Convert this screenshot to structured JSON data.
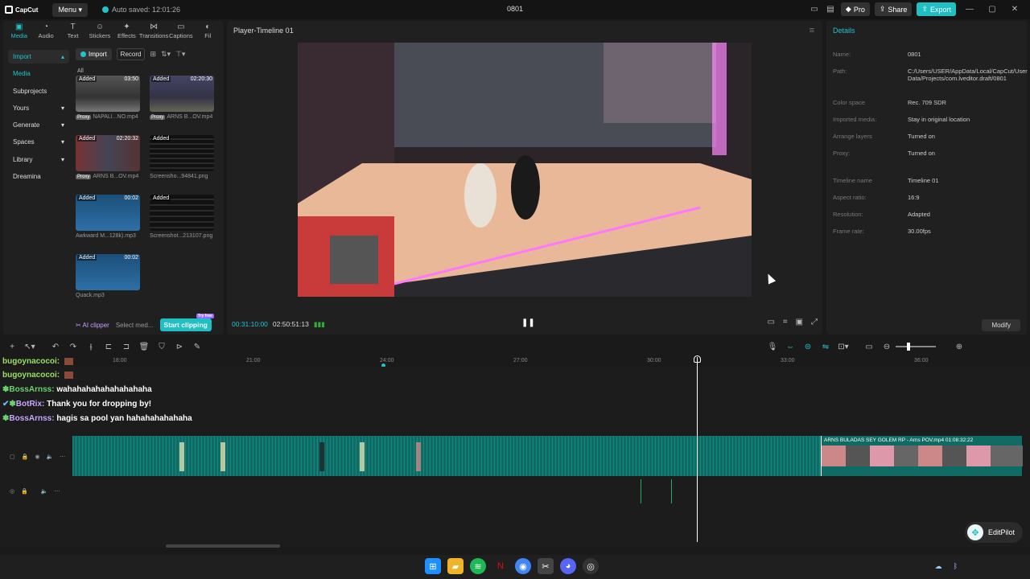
{
  "titlebar": {
    "logo": "CapCut",
    "menu": "Menu",
    "autosave": "Auto saved: 12:01:26",
    "project": "0801",
    "pro": "Pro",
    "share": "Share",
    "export": "Export"
  },
  "media": {
    "tabs": [
      "Media",
      "Audio",
      "Text",
      "Stickers",
      "Effects",
      "Transitions",
      "Captions",
      "Fil"
    ],
    "nav": [
      "Import",
      "Media",
      "Subprojects",
      "Yours",
      "Generate",
      "Spaces",
      "Library",
      "Dreamina"
    ],
    "import_btn": "Import",
    "record_btn": "Record",
    "all": "All",
    "items": [
      {
        "added": "Added",
        "dur": "03:50",
        "name": "NAPALI...NO.mp4",
        "proxy": "Proxy"
      },
      {
        "added": "Added",
        "dur": "02:20:30",
        "name": "ARNS B...OV.mp4",
        "proxy": "Proxy"
      },
      {
        "added": "Added",
        "dur": "02:20:32",
        "name": "ARNS B...OV.mp4",
        "proxy": "Proxy"
      },
      {
        "added": "Added",
        "dur": "",
        "name": "Screensho...94841.png",
        "proxy": ""
      },
      {
        "added": "Added",
        "dur": "00:02",
        "name": "Awkward M...128k).mp3",
        "proxy": ""
      },
      {
        "added": "Added",
        "dur": "",
        "name": "Screenshot...213107.png",
        "proxy": ""
      },
      {
        "added": "Added",
        "dur": "00:02",
        "name": "Quack.mp3",
        "proxy": ""
      }
    ],
    "ai_clipper": "AI clipper",
    "select_media": "Select med...",
    "start_clipping": "Start clipping",
    "try_free": "Try free"
  },
  "player": {
    "title": "Player-Timeline 01",
    "current_time": "00:31:10:00",
    "total_time": "02:50:51:13"
  },
  "details": {
    "heading": "Details",
    "rows": [
      {
        "k": "Name:",
        "v": "0801"
      },
      {
        "k": "Path:",
        "v": "C:/Users/USER/AppData/Local/CapCut/User Data/Projects/com.lveditor.draft/0801"
      },
      {
        "k": "Color space",
        "v": "Rec. 709 SDR"
      },
      {
        "k": "Imported media:",
        "v": "Stay in original location"
      },
      {
        "k": "Arrange layers",
        "v": "Turned on"
      },
      {
        "k": "Proxy:",
        "v": "Turned on"
      },
      {
        "k": "Timeline name",
        "v": "Timeline 01"
      },
      {
        "k": "Aspect ratio:",
        "v": "16:9"
      },
      {
        "k": "Resolution:",
        "v": "Adapted"
      },
      {
        "k": "Frame rate:",
        "v": "30.00fps"
      }
    ],
    "modify": "Modify"
  },
  "timeline": {
    "ticks": [
      "18:00",
      "21:00",
      "24:00",
      "27:00",
      "30:00",
      "33:00",
      "36:00"
    ],
    "chat": [
      {
        "user": "bugoynacocoi:",
        "msg": ""
      },
      {
        "user": "bugoynacocoi:",
        "msg": ""
      },
      {
        "user": "BossArnss:",
        "msg": "wahahahahahahahahaha"
      },
      {
        "user": "BotRix:",
        "msg": "Thank you for dropping by!"
      },
      {
        "user": "BossArnss:",
        "msg": "hagis sa pool yan hahahahahahaha"
      }
    ],
    "clip_label": "ARNS BULADAS SEY GOLEM RP - Arns POV.mp4",
    "clip_duration": "01:08:32:22",
    "editpilot": "EditPilot"
  }
}
